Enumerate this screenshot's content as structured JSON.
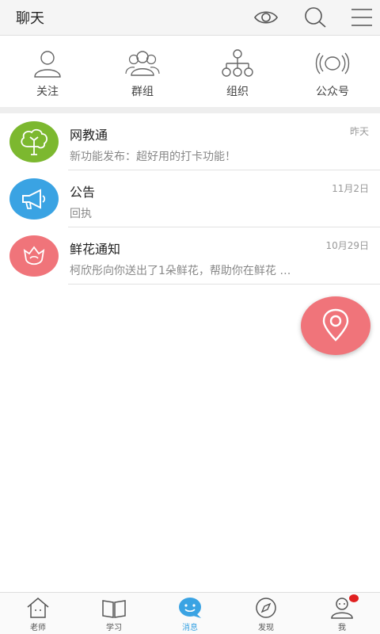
{
  "header": {
    "title": "聊天",
    "icons": [
      "eye-icon",
      "search-icon",
      "menu-icon"
    ]
  },
  "quick_actions": [
    {
      "label": "关注",
      "icon": "person-icon"
    },
    {
      "label": "群组",
      "icon": "group-icon"
    },
    {
      "label": "组织",
      "icon": "org-chart-icon"
    },
    {
      "label": "公众号",
      "icon": "broadcast-icon"
    }
  ],
  "messages": [
    {
      "name": "网教通",
      "time": "昨天",
      "preview": "新功能发布：超好用的打卡功能！",
      "avatar_color": "#7cb82f",
      "icon": "tree-icon"
    },
    {
      "name": "公告",
      "time": "11月2日",
      "preview": "回执",
      "avatar_color": "#3aa3e3",
      "icon": "megaphone-icon"
    },
    {
      "name": "鲜花通知",
      "time": "10月29日",
      "preview": "柯欣彤向你送出了1朵鲜花，帮助你在鲜花 …",
      "avatar_color": "#f0747a",
      "icon": "flower-icon"
    }
  ],
  "fab": {
    "icon": "location-pin-icon",
    "color": "#f0747a"
  },
  "tabbar": {
    "items": [
      {
        "label": "老师",
        "icon": "home-icon"
      },
      {
        "label": "学习",
        "icon": "book-icon"
      },
      {
        "label": "消息",
        "icon": "chat-icon",
        "active": true
      },
      {
        "label": "发现",
        "icon": "compass-icon"
      },
      {
        "label": "我",
        "icon": "profile-icon",
        "badge": true
      }
    ],
    "active_color": "#3aa3e3"
  }
}
